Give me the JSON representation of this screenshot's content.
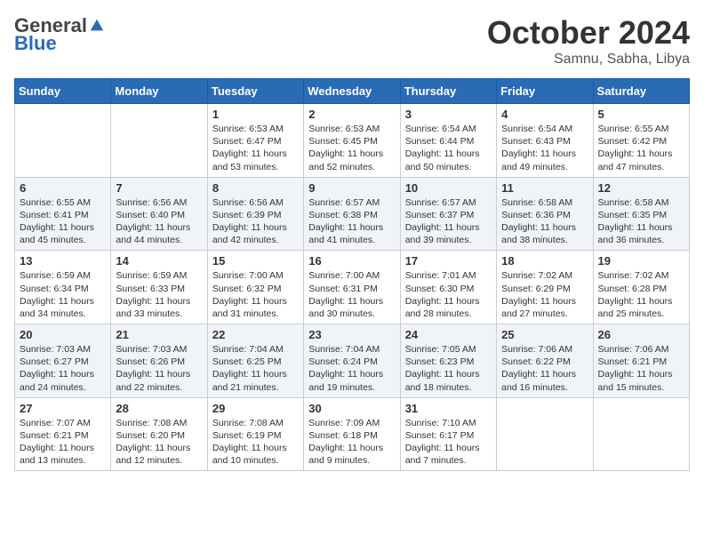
{
  "header": {
    "logo_general": "General",
    "logo_blue": "Blue",
    "month": "October 2024",
    "location": "Samnu, Sabha, Libya"
  },
  "weekdays": [
    "Sunday",
    "Monday",
    "Tuesday",
    "Wednesday",
    "Thursday",
    "Friday",
    "Saturday"
  ],
  "weeks": [
    [
      {
        "day": "",
        "sunrise": "",
        "sunset": "",
        "daylight": ""
      },
      {
        "day": "",
        "sunrise": "",
        "sunset": "",
        "daylight": ""
      },
      {
        "day": "1",
        "sunrise": "Sunrise: 6:53 AM",
        "sunset": "Sunset: 6:47 PM",
        "daylight": "Daylight: 11 hours and 53 minutes."
      },
      {
        "day": "2",
        "sunrise": "Sunrise: 6:53 AM",
        "sunset": "Sunset: 6:45 PM",
        "daylight": "Daylight: 11 hours and 52 minutes."
      },
      {
        "day": "3",
        "sunrise": "Sunrise: 6:54 AM",
        "sunset": "Sunset: 6:44 PM",
        "daylight": "Daylight: 11 hours and 50 minutes."
      },
      {
        "day": "4",
        "sunrise": "Sunrise: 6:54 AM",
        "sunset": "Sunset: 6:43 PM",
        "daylight": "Daylight: 11 hours and 49 minutes."
      },
      {
        "day": "5",
        "sunrise": "Sunrise: 6:55 AM",
        "sunset": "Sunset: 6:42 PM",
        "daylight": "Daylight: 11 hours and 47 minutes."
      }
    ],
    [
      {
        "day": "6",
        "sunrise": "Sunrise: 6:55 AM",
        "sunset": "Sunset: 6:41 PM",
        "daylight": "Daylight: 11 hours and 45 minutes."
      },
      {
        "day": "7",
        "sunrise": "Sunrise: 6:56 AM",
        "sunset": "Sunset: 6:40 PM",
        "daylight": "Daylight: 11 hours and 44 minutes."
      },
      {
        "day": "8",
        "sunrise": "Sunrise: 6:56 AM",
        "sunset": "Sunset: 6:39 PM",
        "daylight": "Daylight: 11 hours and 42 minutes."
      },
      {
        "day": "9",
        "sunrise": "Sunrise: 6:57 AM",
        "sunset": "Sunset: 6:38 PM",
        "daylight": "Daylight: 11 hours and 41 minutes."
      },
      {
        "day": "10",
        "sunrise": "Sunrise: 6:57 AM",
        "sunset": "Sunset: 6:37 PM",
        "daylight": "Daylight: 11 hours and 39 minutes."
      },
      {
        "day": "11",
        "sunrise": "Sunrise: 6:58 AM",
        "sunset": "Sunset: 6:36 PM",
        "daylight": "Daylight: 11 hours and 38 minutes."
      },
      {
        "day": "12",
        "sunrise": "Sunrise: 6:58 AM",
        "sunset": "Sunset: 6:35 PM",
        "daylight": "Daylight: 11 hours and 36 minutes."
      }
    ],
    [
      {
        "day": "13",
        "sunrise": "Sunrise: 6:59 AM",
        "sunset": "Sunset: 6:34 PM",
        "daylight": "Daylight: 11 hours and 34 minutes."
      },
      {
        "day": "14",
        "sunrise": "Sunrise: 6:59 AM",
        "sunset": "Sunset: 6:33 PM",
        "daylight": "Daylight: 11 hours and 33 minutes."
      },
      {
        "day": "15",
        "sunrise": "Sunrise: 7:00 AM",
        "sunset": "Sunset: 6:32 PM",
        "daylight": "Daylight: 11 hours and 31 minutes."
      },
      {
        "day": "16",
        "sunrise": "Sunrise: 7:00 AM",
        "sunset": "Sunset: 6:31 PM",
        "daylight": "Daylight: 11 hours and 30 minutes."
      },
      {
        "day": "17",
        "sunrise": "Sunrise: 7:01 AM",
        "sunset": "Sunset: 6:30 PM",
        "daylight": "Daylight: 11 hours and 28 minutes."
      },
      {
        "day": "18",
        "sunrise": "Sunrise: 7:02 AM",
        "sunset": "Sunset: 6:29 PM",
        "daylight": "Daylight: 11 hours and 27 minutes."
      },
      {
        "day": "19",
        "sunrise": "Sunrise: 7:02 AM",
        "sunset": "Sunset: 6:28 PM",
        "daylight": "Daylight: 11 hours and 25 minutes."
      }
    ],
    [
      {
        "day": "20",
        "sunrise": "Sunrise: 7:03 AM",
        "sunset": "Sunset: 6:27 PM",
        "daylight": "Daylight: 11 hours and 24 minutes."
      },
      {
        "day": "21",
        "sunrise": "Sunrise: 7:03 AM",
        "sunset": "Sunset: 6:26 PM",
        "daylight": "Daylight: 11 hours and 22 minutes."
      },
      {
        "day": "22",
        "sunrise": "Sunrise: 7:04 AM",
        "sunset": "Sunset: 6:25 PM",
        "daylight": "Daylight: 11 hours and 21 minutes."
      },
      {
        "day": "23",
        "sunrise": "Sunrise: 7:04 AM",
        "sunset": "Sunset: 6:24 PM",
        "daylight": "Daylight: 11 hours and 19 minutes."
      },
      {
        "day": "24",
        "sunrise": "Sunrise: 7:05 AM",
        "sunset": "Sunset: 6:23 PM",
        "daylight": "Daylight: 11 hours and 18 minutes."
      },
      {
        "day": "25",
        "sunrise": "Sunrise: 7:06 AM",
        "sunset": "Sunset: 6:22 PM",
        "daylight": "Daylight: 11 hours and 16 minutes."
      },
      {
        "day": "26",
        "sunrise": "Sunrise: 7:06 AM",
        "sunset": "Sunset: 6:21 PM",
        "daylight": "Daylight: 11 hours and 15 minutes."
      }
    ],
    [
      {
        "day": "27",
        "sunrise": "Sunrise: 7:07 AM",
        "sunset": "Sunset: 6:21 PM",
        "daylight": "Daylight: 11 hours and 13 minutes."
      },
      {
        "day": "28",
        "sunrise": "Sunrise: 7:08 AM",
        "sunset": "Sunset: 6:20 PM",
        "daylight": "Daylight: 11 hours and 12 minutes."
      },
      {
        "day": "29",
        "sunrise": "Sunrise: 7:08 AM",
        "sunset": "Sunset: 6:19 PM",
        "daylight": "Daylight: 11 hours and 10 minutes."
      },
      {
        "day": "30",
        "sunrise": "Sunrise: 7:09 AM",
        "sunset": "Sunset: 6:18 PM",
        "daylight": "Daylight: 11 hours and 9 minutes."
      },
      {
        "day": "31",
        "sunrise": "Sunrise: 7:10 AM",
        "sunset": "Sunset: 6:17 PM",
        "daylight": "Daylight: 11 hours and 7 minutes."
      },
      {
        "day": "",
        "sunrise": "",
        "sunset": "",
        "daylight": ""
      },
      {
        "day": "",
        "sunrise": "",
        "sunset": "",
        "daylight": ""
      }
    ]
  ]
}
